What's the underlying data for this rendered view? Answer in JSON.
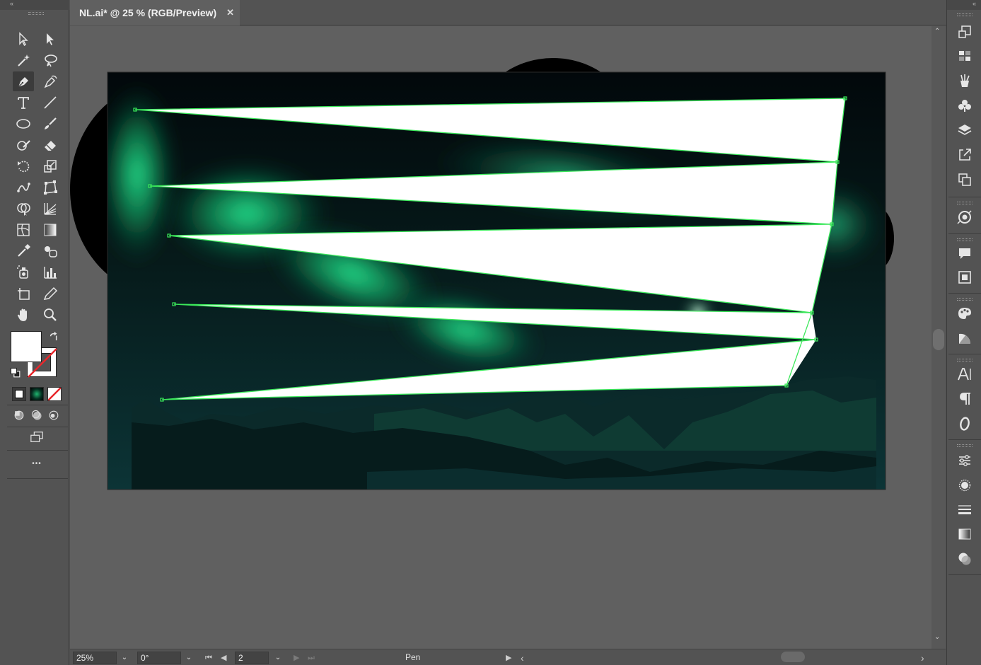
{
  "document_tab": {
    "title": "NL.ai* @ 25 % (RGB/Preview)",
    "close_glyph": "✕"
  },
  "collapse_glyphs": {
    "left": "«",
    "right": "«"
  },
  "left_toolbar": {
    "tools": [
      "selection-tool",
      "direct-selection-tool",
      "magic-wand-tool",
      "lasso-tool",
      "pen-tool",
      "curvature-tool",
      "type-tool",
      "line-segment-tool",
      "ellipse-tool",
      "paintbrush-tool",
      "shaper-tool",
      "eraser-tool",
      "rotate-tool",
      "scale-tool",
      "puppet-warp-tool",
      "free-transform-tool",
      "shape-builder-tool",
      "perspective-grid-tool",
      "mesh-tool",
      "gradient-tool",
      "eyedropper-tool",
      "blend-tool",
      "symbol-sprayer-tool",
      "column-graph-tool",
      "artboard-tool",
      "slice-tool",
      "hand-tool",
      "zoom-tool"
    ],
    "active_tool": "pen-tool",
    "fill_color": "#ffffff",
    "stroke": "none",
    "more_glyph": "•••"
  },
  "status_bar": {
    "zoom": "25%",
    "rotation": "0°",
    "artboard_number": "2",
    "current_tool": "Pen",
    "nav_first": "⏮",
    "nav_prev": "◀",
    "nav_next": "▶",
    "nav_last": "⏭",
    "dropdown_glyph": "⌄",
    "play_glyph": "▶",
    "scroll_left_glyph": "‹",
    "scroll_right_glyph": "›"
  },
  "vertical_scrollbar": {
    "up_glyph": "⌃",
    "down_glyph": "⌄"
  },
  "right_panel": {
    "icons": [
      "transform-icon",
      "align-icon",
      "libraries-icon",
      "symbols-icon",
      "layers-icon",
      "export-icon",
      "artboards-icon",
      "recolor-icon",
      "comments-icon",
      "properties-icon",
      "color-icon",
      "color-guide-icon",
      "character-icon",
      "paragraph-icon",
      "opentype-icon",
      "stroke-options-icon",
      "appearance-icon",
      "stroke-icon",
      "gradient-icon",
      "transparency-icon"
    ]
  },
  "colors": {
    "aurora": "#21e88c",
    "selection_path": "#3be85a",
    "artboard_bg": "#051418",
    "panel": "#535353",
    "canvas": "#606060"
  }
}
